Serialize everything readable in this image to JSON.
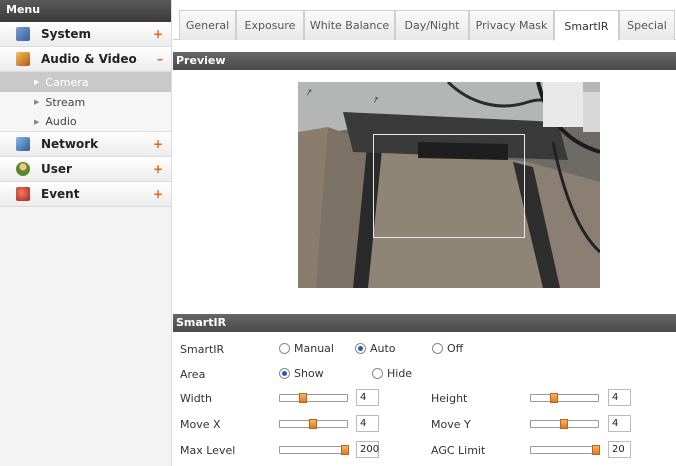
{
  "sidebar": {
    "header": "Menu",
    "items": [
      {
        "label": "System",
        "toggle": "+"
      },
      {
        "label": "Audio & Video",
        "toggle": "–",
        "sub": [
          "Camera",
          "Stream",
          "Audio"
        ]
      },
      {
        "label": "Network",
        "toggle": "+"
      },
      {
        "label": "User",
        "toggle": "+"
      },
      {
        "label": "Event",
        "toggle": "+"
      }
    ]
  },
  "tabs": [
    "General",
    "Exposure",
    "White Balance",
    "Day/Night",
    "Privacy Mask",
    "SmartIR",
    "Special"
  ],
  "active_tab": "SmartIR",
  "preview": {
    "title": "Preview"
  },
  "smartir": {
    "title": "SmartIR",
    "mode_label": "SmartIR",
    "mode_options": [
      "Manual",
      "Auto",
      "Off"
    ],
    "mode_selected": "Auto",
    "area_label": "Area",
    "area_options": [
      "Show",
      "Hide"
    ],
    "area_selected": "Show",
    "width_label": "Width",
    "width_value": "4",
    "height_label": "Height",
    "height_value": "4",
    "movex_label": "Move X",
    "movex_value": "4",
    "movey_label": "Move Y",
    "movey_value": "4",
    "maxlevel_label": "Max Level",
    "maxlevel_value": "200",
    "agc_label": "AGC Limit",
    "agc_value": "20"
  },
  "colors": {
    "accent": "#e07a1a",
    "header_bar": "#4a4a4a"
  }
}
